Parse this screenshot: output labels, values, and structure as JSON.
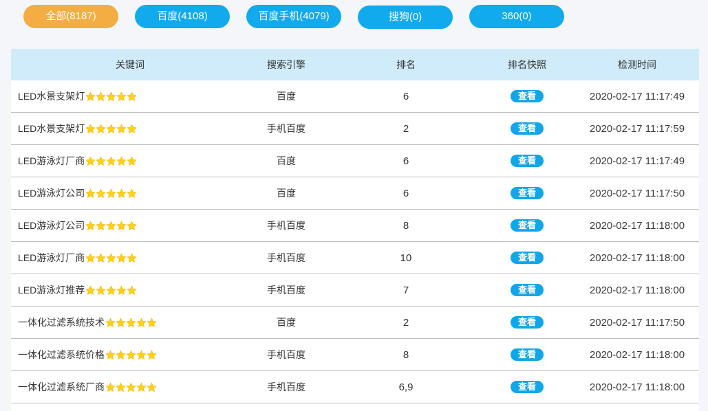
{
  "filters": [
    {
      "label": "全部(8187)",
      "style": "orange"
    },
    {
      "label": "百度(4108)",
      "style": "blue"
    },
    {
      "label": "百度手机(4079)",
      "style": "blue"
    },
    {
      "label": "搜狗(0)",
      "style": "blue"
    },
    {
      "label": "360(0)",
      "style": "blue"
    }
  ],
  "colors": {
    "accent_blue": "#11aaec",
    "accent_orange": "#f4ad42",
    "header_bg": "#d0ecfb",
    "star": "#ffd21a"
  },
  "table": {
    "headers": {
      "keyword": "关键词",
      "engine": "搜索引擎",
      "rank": "排名",
      "snapshot": "排名快照",
      "time": "检测时间"
    },
    "view_label": "查看",
    "star_icon": "star-icon",
    "rows": [
      {
        "keyword": "LED水景支架灯",
        "stars": 5,
        "engine": "百度",
        "rank": "6",
        "time": "2020-02-17 11:17:49"
      },
      {
        "keyword": "LED水景支架灯",
        "stars": 5,
        "engine": "手机百度",
        "rank": "2",
        "time": "2020-02-17 11:17:59"
      },
      {
        "keyword": "LED游泳灯厂商",
        "stars": 5,
        "engine": "百度",
        "rank": "6",
        "time": "2020-02-17 11:17:49"
      },
      {
        "keyword": "LED游泳灯公司",
        "stars": 5,
        "engine": "百度",
        "rank": "6",
        "time": "2020-02-17 11:17:50"
      },
      {
        "keyword": "LED游泳灯公司",
        "stars": 5,
        "engine": "手机百度",
        "rank": "8",
        "time": "2020-02-17 11:18:00"
      },
      {
        "keyword": "LED游泳灯厂商",
        "stars": 5,
        "engine": "手机百度",
        "rank": "10",
        "time": "2020-02-17 11:18:00"
      },
      {
        "keyword": "LED游泳灯推荐",
        "stars": 5,
        "engine": "手机百度",
        "rank": "7",
        "time": "2020-02-17 11:18:00"
      },
      {
        "keyword": "一体化过滤系统技术",
        "stars": 5,
        "engine": "百度",
        "rank": "2",
        "time": "2020-02-17 11:17:50"
      },
      {
        "keyword": "一体化过滤系统价格",
        "stars": 5,
        "engine": "手机百度",
        "rank": "8",
        "time": "2020-02-17 11:18:00"
      },
      {
        "keyword": "一体化过滤系统厂商",
        "stars": 5,
        "engine": "手机百度",
        "rank": "6,9",
        "time": "2020-02-17 11:18:00"
      }
    ]
  }
}
